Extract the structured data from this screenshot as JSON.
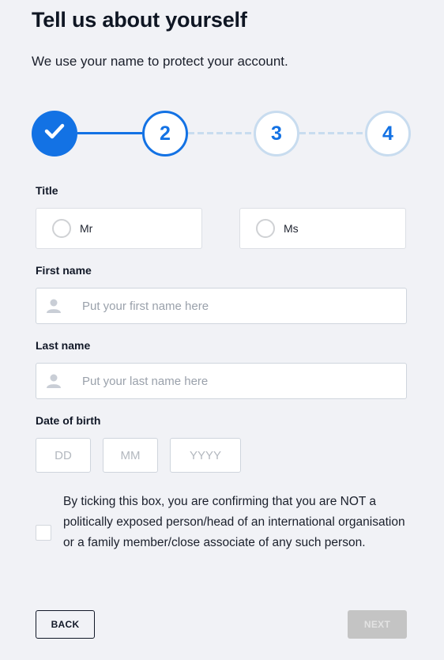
{
  "header": {
    "title": "Tell us about yourself",
    "subtitle": "We use your name to protect your account."
  },
  "stepper": {
    "current_step": 2,
    "total_steps": 4,
    "steps": [
      {
        "label": "1",
        "state": "completed",
        "icon": "check-icon"
      },
      {
        "label": "2",
        "state": "active"
      },
      {
        "label": "3",
        "state": "upcoming"
      },
      {
        "label": "4",
        "state": "upcoming"
      }
    ],
    "colors": {
      "active": "#1372e4",
      "upcoming": "#c8dcef"
    }
  },
  "form": {
    "title_label": "Title",
    "title_options": [
      {
        "label": "Mr",
        "selected": false
      },
      {
        "label": "Ms",
        "selected": false
      }
    ],
    "first_name": {
      "label": "First name",
      "value": "",
      "placeholder": "Put your first name here",
      "icon": "person-icon"
    },
    "last_name": {
      "label": "Last name",
      "value": "",
      "placeholder": "Put your last name here",
      "icon": "person-icon"
    },
    "dob": {
      "label": "Date of birth",
      "day": {
        "value": "",
        "placeholder": "DD"
      },
      "month": {
        "value": "",
        "placeholder": "MM"
      },
      "year": {
        "value": "",
        "placeholder": "YYYY"
      }
    },
    "consent": {
      "checked": false,
      "text": "By ticking this box, you are confirming that you are NOT a politically exposed person/head of an international organisation or a family member/close associate of any such person."
    }
  },
  "buttons": {
    "back": "BACK",
    "next": "NEXT",
    "next_disabled": true
  }
}
